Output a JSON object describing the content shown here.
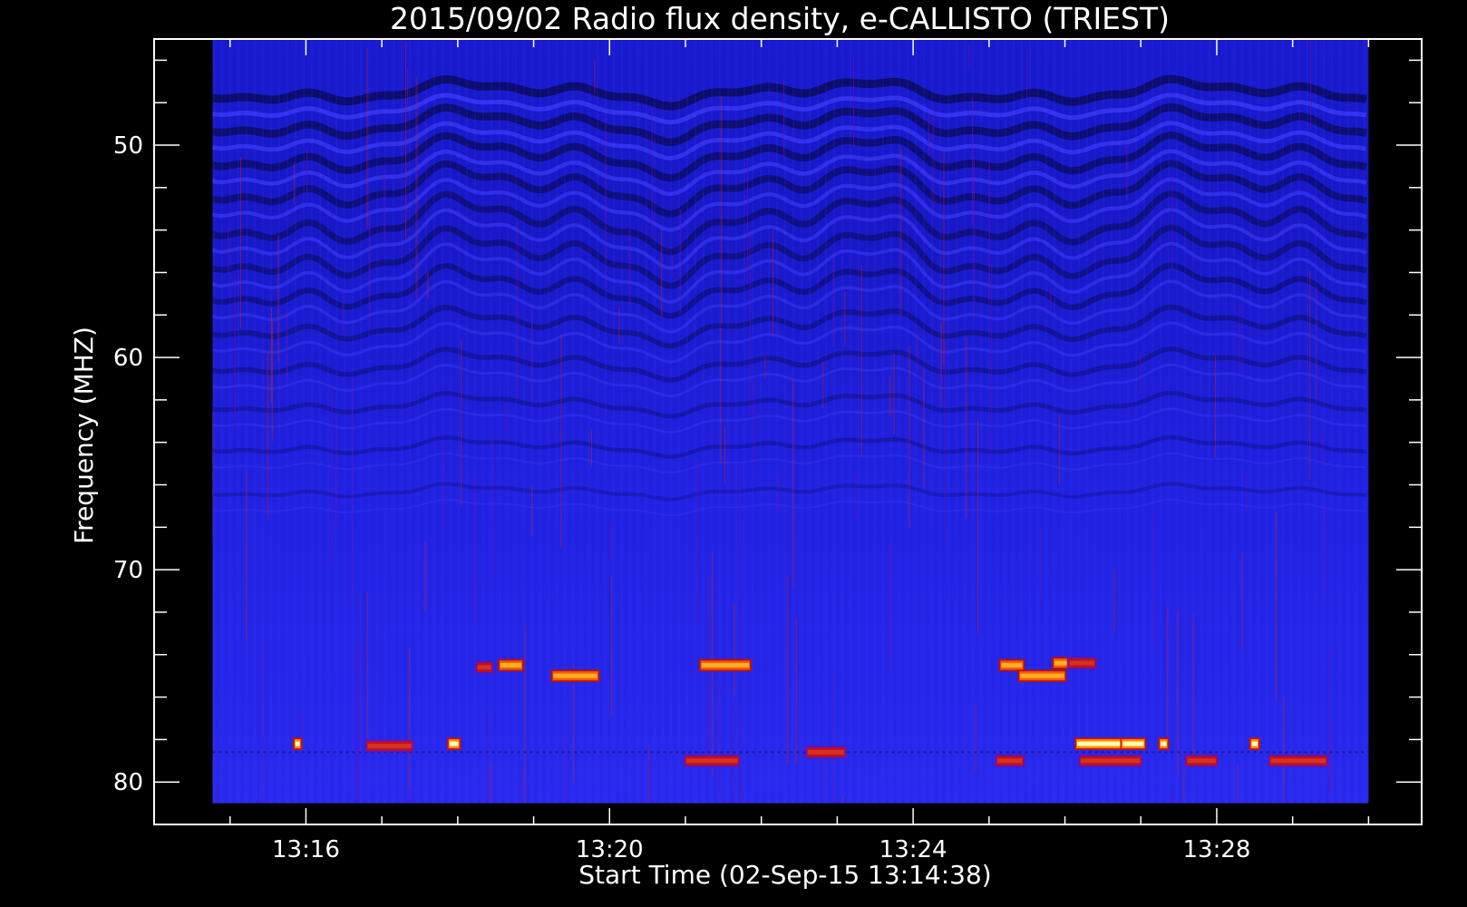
{
  "chart_data": {
    "type": "heatmap",
    "title": "2015/09/02  Radio flux density, e-CALLISTO (TRIEST)",
    "xlabel": "Start Time (02-Sep-15 13:14:38)",
    "ylabel": "Frequency (MHZ)",
    "x_ticks": [
      "13:16",
      "13:20",
      "13:24",
      "13:28"
    ],
    "x_tick_minutes": [
      16,
      20,
      24,
      28
    ],
    "y_ticks": [
      "50",
      "60",
      "70",
      "80"
    ],
    "y_tick_values": [
      50,
      60,
      70,
      80
    ],
    "xlim_minutes": [
      14.0,
      30.7
    ],
    "xdata_minutes": [
      14.77,
      30.0
    ],
    "ylim": [
      45.0,
      82.0
    ],
    "ydata": [
      45.0,
      81.0
    ],
    "y_inverted": true,
    "grid": false,
    "legend": "none",
    "colors": {
      "background": "#000000",
      "axes": "#ffffff",
      "low": "#1c1cd8",
      "mid": "#2a2af0",
      "dark_band": "#0a0a5a",
      "burst_red": "#d01000",
      "burst_orange": "#ff6a00",
      "burst_yellow": "#ffffa0"
    },
    "features": {
      "wave_bands": [
        {
          "freq": 47.5,
          "amp": 0.35
        },
        {
          "freq": 49.0,
          "amp": 0.45
        },
        {
          "freq": 50.5,
          "amp": 0.55
        },
        {
          "freq": 52.0,
          "amp": 0.65
        },
        {
          "freq": 53.6,
          "amp": 0.75
        },
        {
          "freq": 55.2,
          "amp": 0.75
        },
        {
          "freq": 56.8,
          "amp": 0.65
        },
        {
          "freq": 58.5,
          "amp": 0.5
        },
        {
          "freq": 60.3,
          "amp": 0.4
        },
        {
          "freq": 62.2,
          "amp": 0.3
        },
        {
          "freq": 64.2,
          "amp": 0.25
        },
        {
          "freq": 66.3,
          "amp": 0.2
        }
      ],
      "bursts": [
        {
          "t0": 18.55,
          "t1": 18.85,
          "f": 74.5,
          "level": "orange"
        },
        {
          "t0": 19.25,
          "t1": 19.85,
          "f": 75.0,
          "level": "orange"
        },
        {
          "t0": 21.2,
          "t1": 21.85,
          "f": 74.5,
          "level": "orange"
        },
        {
          "t0": 25.15,
          "t1": 25.45,
          "f": 74.5,
          "level": "orange"
        },
        {
          "t0": 25.4,
          "t1": 26.0,
          "f": 75.0,
          "level": "orange"
        },
        {
          "t0": 25.85,
          "t1": 26.05,
          "f": 74.4,
          "level": "orange"
        },
        {
          "t0": 26.15,
          "t1": 26.75,
          "f": 78.2,
          "level": "yellow"
        },
        {
          "t0": 26.75,
          "t1": 27.05,
          "f": 78.2,
          "level": "yellow"
        },
        {
          "t0": 27.25,
          "t1": 27.35,
          "f": 78.2,
          "level": "yellow"
        },
        {
          "t0": 15.85,
          "t1": 15.93,
          "f": 78.2,
          "level": "yellow"
        },
        {
          "t0": 17.88,
          "t1": 18.02,
          "f": 78.2,
          "level": "yellow"
        },
        {
          "t0": 28.45,
          "t1": 28.55,
          "f": 78.2,
          "level": "yellow"
        },
        {
          "t0": 16.8,
          "t1": 17.4,
          "f": 78.3,
          "level": "red"
        },
        {
          "t0": 18.25,
          "t1": 18.45,
          "f": 74.6,
          "level": "red"
        },
        {
          "t0": 21.0,
          "t1": 21.7,
          "f": 79.0,
          "level": "red"
        },
        {
          "t0": 22.6,
          "t1": 23.1,
          "f": 78.6,
          "level": "red"
        },
        {
          "t0": 26.2,
          "t1": 27.0,
          "f": 79.0,
          "level": "red"
        },
        {
          "t0": 27.6,
          "t1": 28.0,
          "f": 79.0,
          "level": "red"
        },
        {
          "t0": 28.7,
          "t1": 29.45,
          "f": 79.0,
          "level": "red"
        },
        {
          "t0": 25.1,
          "t1": 25.45,
          "f": 79.0,
          "level": "red"
        },
        {
          "t0": 26.05,
          "t1": 26.4,
          "f": 74.4,
          "level": "red"
        }
      ]
    }
  }
}
